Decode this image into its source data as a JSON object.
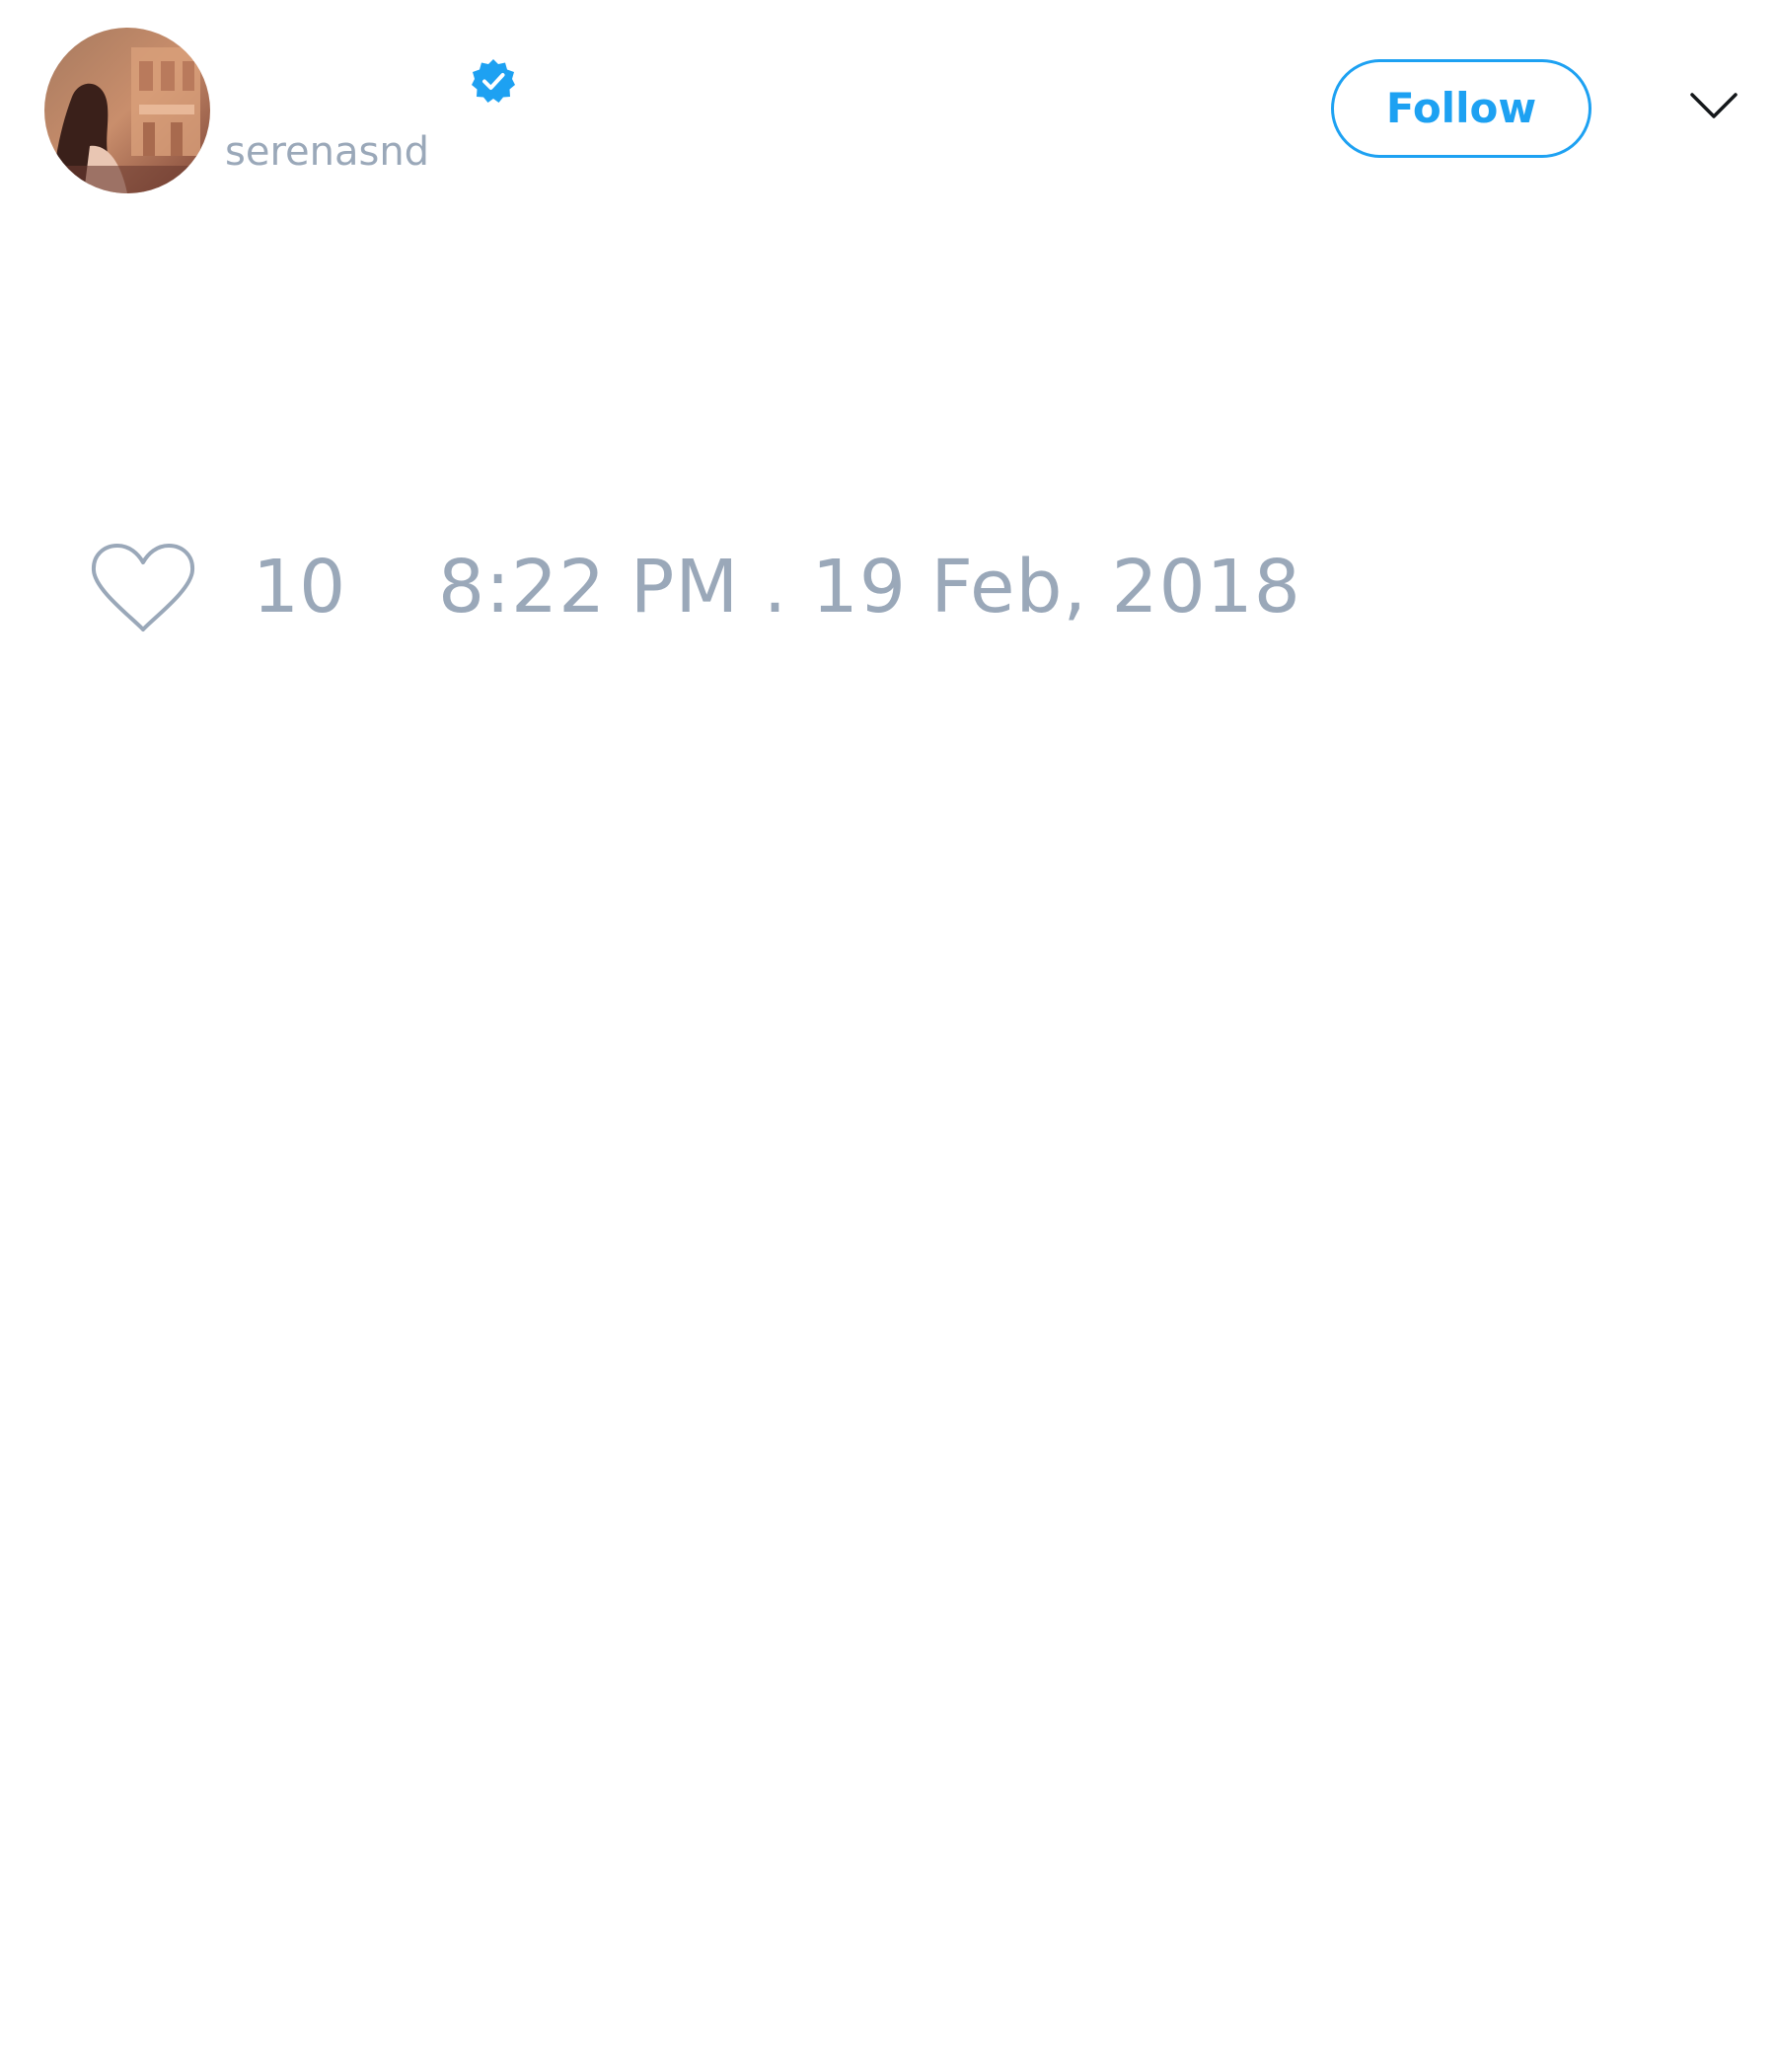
{
  "tweet": {
    "author": {
      "handle": "serenasnd",
      "verified": true,
      "avatar_icon": "profile-photo"
    },
    "follow_label": "Follow",
    "menu_icon": "chevron-down-icon",
    "like_icon": "heart-outline-icon",
    "likes_count": "10",
    "timestamp": "8:22 PM . 19 Feb, 2018"
  },
  "colors": {
    "accent": "#1da1f2",
    "muted_text": "#9aa8b9",
    "background": "#ffffff"
  }
}
